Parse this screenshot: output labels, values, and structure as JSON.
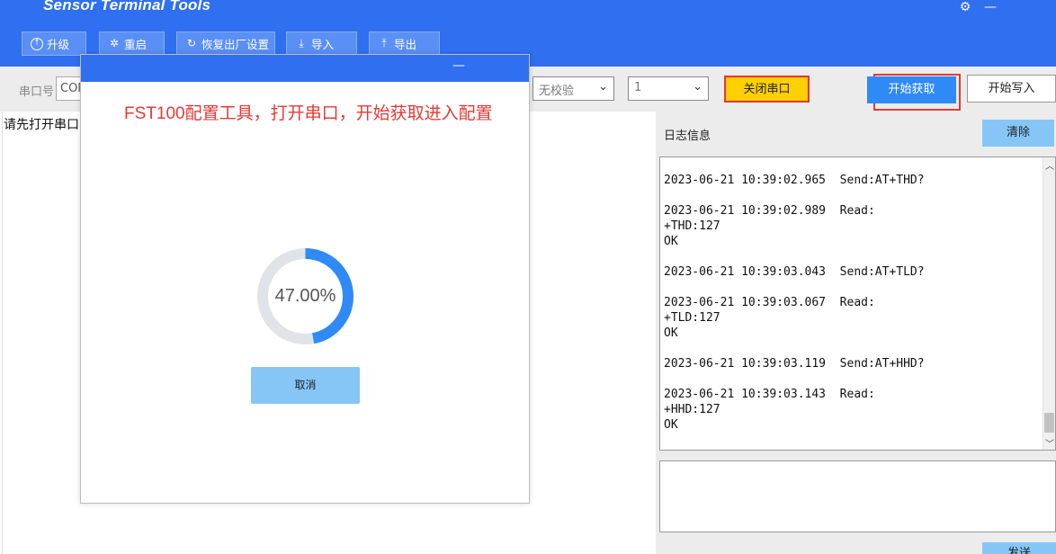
{
  "window": {
    "title": "Sensor Terminal Tools",
    "settings_icon": "gear-icon",
    "minimize_glyph": "—"
  },
  "toolbar": {
    "buttons": [
      {
        "label": "升级",
        "icon": "upload-circle-icon"
      },
      {
        "label": "重启",
        "icon": "spinner-icon"
      },
      {
        "label": "恢复出厂设置",
        "icon": "refresh-icon"
      },
      {
        "label": "导入",
        "icon": "import-icon"
      },
      {
        "label": "导出",
        "icon": "export-icon"
      }
    ]
  },
  "settings": {
    "port_label": "串口号",
    "port_value": "COM",
    "parity_value": "无校验",
    "stopbits_value": "1",
    "close_port_label": "关闭串口",
    "start_read_label": "开始获取",
    "start_write_label": "开始写入"
  },
  "left": {
    "status_text": "请先打开串口"
  },
  "log": {
    "title": "日志信息",
    "clear_label": "清除",
    "send_label": "发送",
    "lines": "2023-06-21 10:39:02.965  Send:AT+THD?\n\n2023-06-21 10:39:02.989  Read:\n+THD:127\nOK\n\n2023-06-21 10:39:03.043  Send:AT+TLD?\n\n2023-06-21 10:39:03.067  Read:\n+TLD:127\nOK\n\n2023-06-21 10:39:03.119  Send:AT+HHD?\n\n2023-06-21 10:39:03.143  Read:\n+HHD:127\nOK"
  },
  "modal": {
    "minimize_glyph": "—",
    "heading": "FST100配置工具，打开串口，开始获取进入配置",
    "progress_fraction": 0.47,
    "progress_text": "47.00%",
    "cancel_label": "取消"
  },
  "colors": {
    "primary": "#2f6ff0",
    "progress": "#2f8af5",
    "progress_track": "#e0e4e8",
    "highlight_red": "#e53935",
    "close_port_yellow": "#ffd000"
  }
}
